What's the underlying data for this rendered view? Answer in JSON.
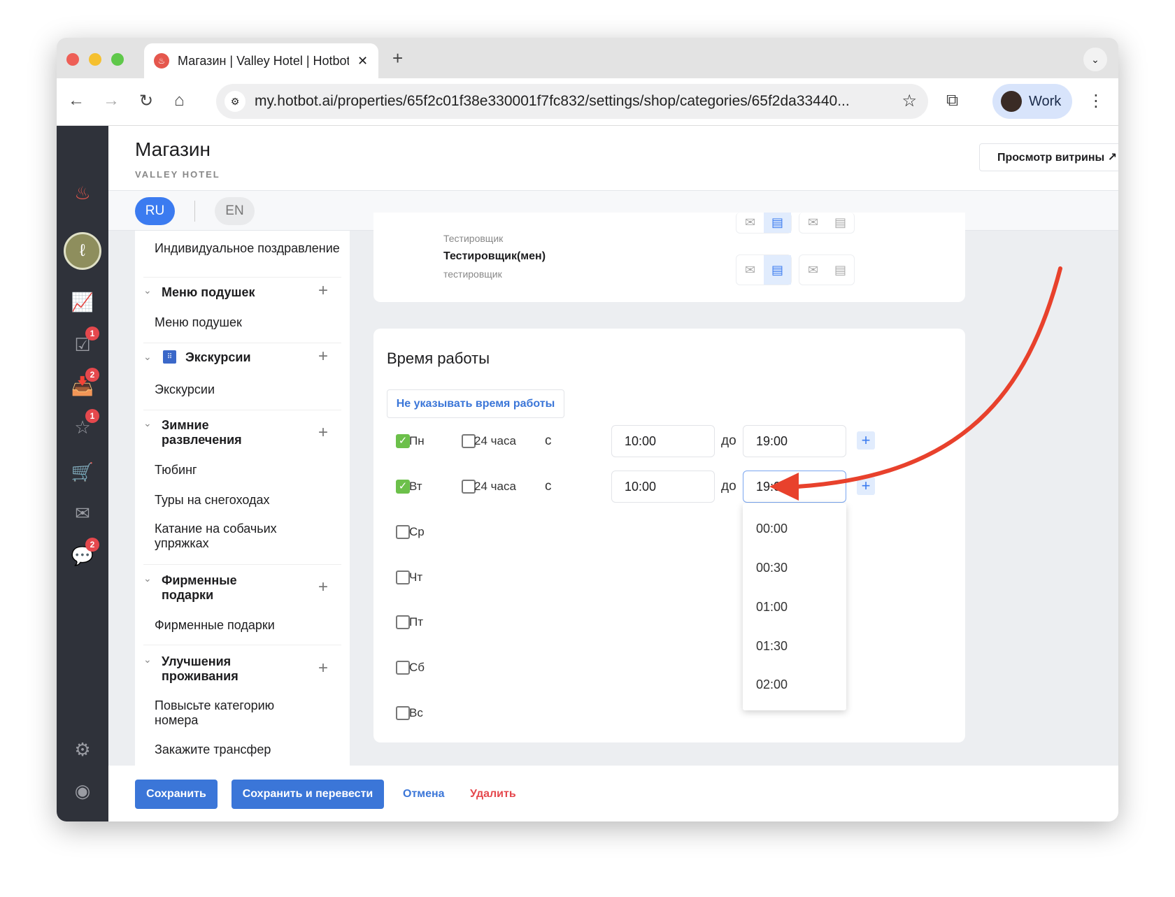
{
  "browser": {
    "tab_title": "Магазин | Valley Hotel | Hotbot",
    "url": "my.hotbot.ai/properties/65f2c01f38e330001f7fc832/settings/shop/categories/65f2da33440...",
    "profile": "Work"
  },
  "sidebar": {
    "badges": {
      "tasks": "1",
      "inbox": "2",
      "reviews": "1",
      "chat": "2"
    }
  },
  "header": {
    "title": "Магазин",
    "subtitle": "VALLEY HOTEL",
    "preview_button": "Просмотр витрины ↗"
  },
  "lang": {
    "ru": "RU",
    "en": "EN"
  },
  "categories": {
    "top_item": "Индивидуальное поздравление",
    "groups": [
      {
        "title": "Меню подушек",
        "items": [
          "Меню подушек"
        ]
      },
      {
        "title": "Экскурсии",
        "items": [
          "Экскурсии"
        ]
      },
      {
        "title": "Зимние развлечения",
        "items": [
          "Тюбинг",
          "Туры на снегоходах",
          "Катание на собачьих упряжках"
        ]
      },
      {
        "title": "Фирменные подарки",
        "items": [
          "Фирменные подарки"
        ]
      },
      {
        "title": "Улучшения проживания",
        "items": [
          "Повысьте категорию номера",
          "Закажите трансфер"
        ]
      }
    ]
  },
  "notify": {
    "rows": [
      {
        "name": "",
        "role": "Тестировщик"
      },
      {
        "name": "Тестировщик(мен)",
        "role": "тестировщик"
      }
    ]
  },
  "hours": {
    "title": "Время работы",
    "no_hours_button": "Не указывать время работы",
    "label_24": "24 часа",
    "label_from": "с",
    "label_to": "до",
    "days": [
      {
        "day": "Пн",
        "enabled": true,
        "from": "10:00",
        "to": "19:00"
      },
      {
        "day": "Вт",
        "enabled": true,
        "from": "10:00",
        "to": "19:00"
      },
      {
        "day": "Ср",
        "enabled": false
      },
      {
        "day": "Чт",
        "enabled": false
      },
      {
        "day": "Пт",
        "enabled": false
      },
      {
        "day": "Сб",
        "enabled": false
      },
      {
        "day": "Вс",
        "enabled": false
      }
    ],
    "dropdown_options": [
      "00:00",
      "00:30",
      "01:00",
      "01:30",
      "02:00"
    ]
  },
  "footer": {
    "save": "Сохранить",
    "save_translate": "Сохранить и перевести",
    "cancel": "Отмена",
    "delete": "Удалить"
  },
  "colors": {
    "accent": "#3b76d8",
    "danger": "#e5484d",
    "sidebar": "#2f323a",
    "check": "#6cc04a",
    "annotation_arrow": "#e8412c"
  }
}
